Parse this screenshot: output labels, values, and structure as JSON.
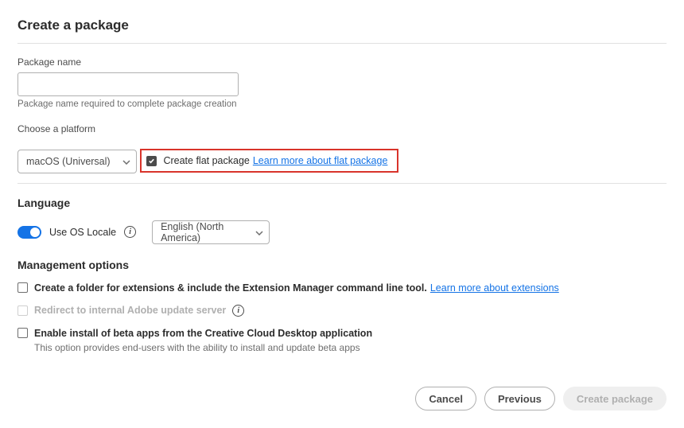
{
  "title": "Create a package",
  "packageName": {
    "label": "Package name",
    "value": "",
    "hint": "Package name required to complete package creation"
  },
  "platform": {
    "label": "Choose a platform",
    "selected": "macOS (Universal)"
  },
  "flatPackage": {
    "checked": true,
    "label": "Create flat package",
    "link": "Learn more about flat package"
  },
  "language": {
    "header": "Language",
    "toggleLabel": "Use OS Locale",
    "toggleOn": true,
    "selected": "English (North America)"
  },
  "management": {
    "header": "Management options",
    "options": [
      {
        "label": "Create a folder for extensions & include the Extension Manager command line tool.",
        "link": "Learn more about extensions",
        "checked": false,
        "disabled": false
      },
      {
        "label": "Redirect to internal Adobe update server",
        "checked": false,
        "disabled": true,
        "hasInfo": true
      },
      {
        "label": "Enable install of beta apps from the Creative Cloud Desktop application",
        "sub": "This option provides end-users with the ability to install and update beta apps",
        "checked": false,
        "disabled": false
      }
    ]
  },
  "buttons": {
    "cancel": "Cancel",
    "previous": "Previous",
    "create": "Create package"
  }
}
